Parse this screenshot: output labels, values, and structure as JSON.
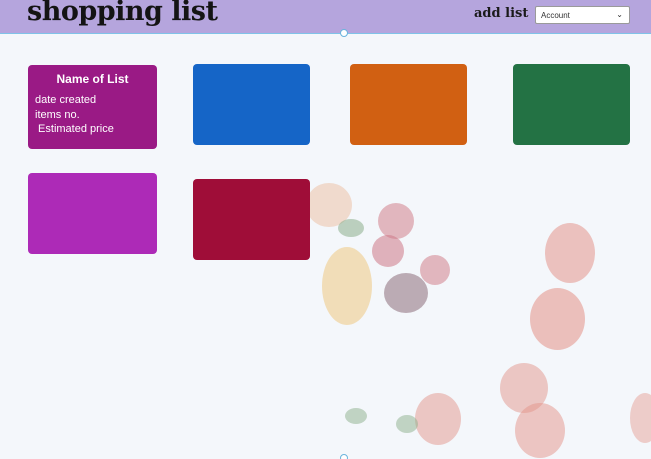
{
  "header": {
    "title": "shopping list",
    "add_list_label": "add list",
    "account_select": {
      "selected": "Account"
    }
  },
  "colors": {
    "header_bg": "#b5a5dd",
    "card_1": "#9a1a85",
    "card_2": "#1565c7",
    "card_3": "#d16012",
    "card_4": "#237244",
    "card_5": "#ad2ab7",
    "card_6": "#9f0d38"
  },
  "lists": [
    {
      "name": "Name of List",
      "date_created": "date created",
      "items_no": "items no.",
      "estimated_price": " Estimated price"
    }
  ]
}
